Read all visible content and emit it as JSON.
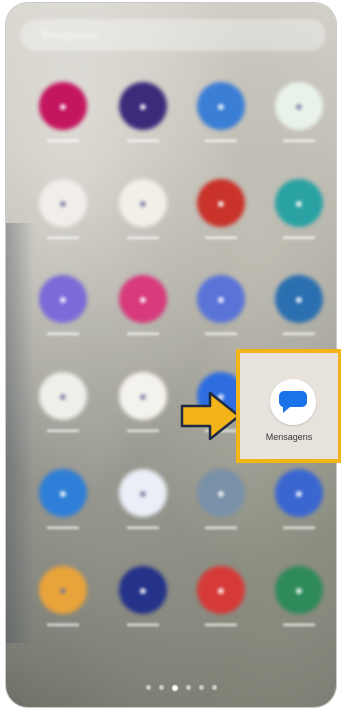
{
  "search": {
    "placeholder": "Pesquisar"
  },
  "highlighted_app": {
    "label": "Mensagens",
    "icon": "messages-icon"
  },
  "annotation": {
    "arrow_color": "#f2b418",
    "box_color": "#f2b418"
  },
  "grid_apps": [
    {
      "icon": "settings-icon",
      "color": "#c4155f"
    },
    {
      "icon": "galaxy-store-icon",
      "color": "#3d2a7a"
    },
    {
      "icon": "gallery-icon",
      "color": "#3b7ed6"
    },
    {
      "icon": "app-green-icon",
      "color": "#e9f2ea"
    },
    {
      "icon": "camera-icon",
      "color": "#f1eeea"
    },
    {
      "icon": "dialer-icon",
      "color": "#f2efe9"
    },
    {
      "icon": "red-app-icon",
      "color": "#c9332a"
    },
    {
      "icon": "green-app-icon",
      "color": "#2aa2a4"
    },
    {
      "icon": "clock-icon",
      "color": "#7c6ad8"
    },
    {
      "icon": "instagram-icon",
      "color": "#d83a7c"
    },
    {
      "icon": "chat-app-icon",
      "color": "#5a73d8"
    },
    {
      "icon": "linkedin-icon",
      "color": "#2a6fb0"
    },
    {
      "icon": "photos-icon",
      "color": "#efefea"
    },
    {
      "icon": "maps-icon",
      "color": "#f4f2ec"
    },
    {
      "icon": "blue-round-app-icon",
      "color": "#2d6de0"
    },
    {
      "icon": "calendar-icon",
      "color": "#2f7fd8"
    },
    {
      "icon": "messenger-icon",
      "color": "#eaeef6"
    },
    {
      "icon": "browser-icon",
      "color": "#7890a8"
    },
    {
      "icon": "multicolor-app-icon",
      "color": "#3a66d0"
    },
    {
      "icon": "files-icon",
      "color": "#e8a33a"
    },
    {
      "icon": "play-app-icon",
      "color": "#24328a"
    },
    {
      "icon": "flipboard-icon",
      "color": "#d63a38"
    },
    {
      "icon": "green-app-2-icon",
      "color": "#2e8a5a"
    }
  ],
  "pager": {
    "dots": 6,
    "active": 3
  }
}
